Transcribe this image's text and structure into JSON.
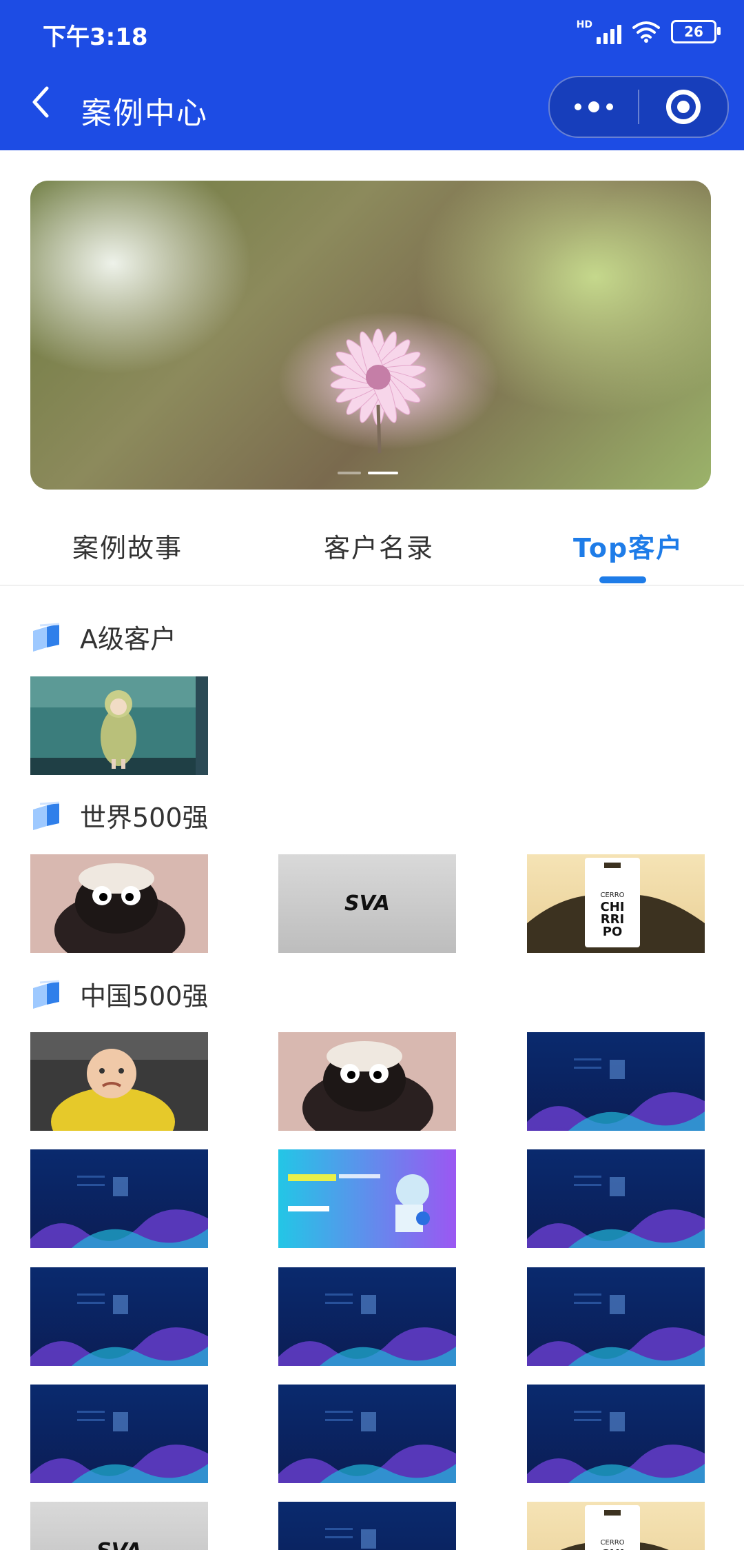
{
  "status_bar": {
    "time": "下午3:18",
    "network": "HD",
    "battery": "26"
  },
  "nav": {
    "title": "案例中心"
  },
  "banner": {
    "slides": 2,
    "active_slide": 2
  },
  "tabs": [
    {
      "label": "案例故事",
      "active": false
    },
    {
      "label": "客户名录",
      "active": false
    },
    {
      "label": "Top客户",
      "active": true
    }
  ],
  "sections": [
    {
      "title": "A级客户",
      "items": [
        {
          "image": "anime-girl-rain"
        }
      ]
    },
    {
      "title": "世界500强",
      "items": [
        {
          "image": "black-sheep-plush"
        },
        {
          "image": "sva-logo",
          "logo_text": "SVA"
        },
        {
          "image": "cerro-chirripo-label",
          "logo_text": "CERRO CHIRRIPO"
        }
      ]
    },
    {
      "title": "中国500强",
      "items": [
        {
          "image": "crying-baby"
        },
        {
          "image": "black-sheep-plush"
        },
        {
          "image": "blue-wave-poster"
        },
        {
          "image": "blue-wave-poster"
        },
        {
          "image": "cyan-purple-tech-banner"
        },
        {
          "image": "blue-wave-poster"
        },
        {
          "image": "blue-wave-poster"
        },
        {
          "image": "blue-wave-poster"
        },
        {
          "image": "blue-wave-poster"
        },
        {
          "image": "blue-wave-poster"
        },
        {
          "image": "blue-wave-poster"
        },
        {
          "image": "blue-wave-poster"
        },
        {
          "image": "sva-logo"
        },
        {
          "image": "blue-wave-poster"
        },
        {
          "image": "cerro-chirripo-label"
        }
      ]
    }
  ],
  "colors": {
    "header": "#1D4CE4",
    "accent": "#1e7ce8"
  }
}
